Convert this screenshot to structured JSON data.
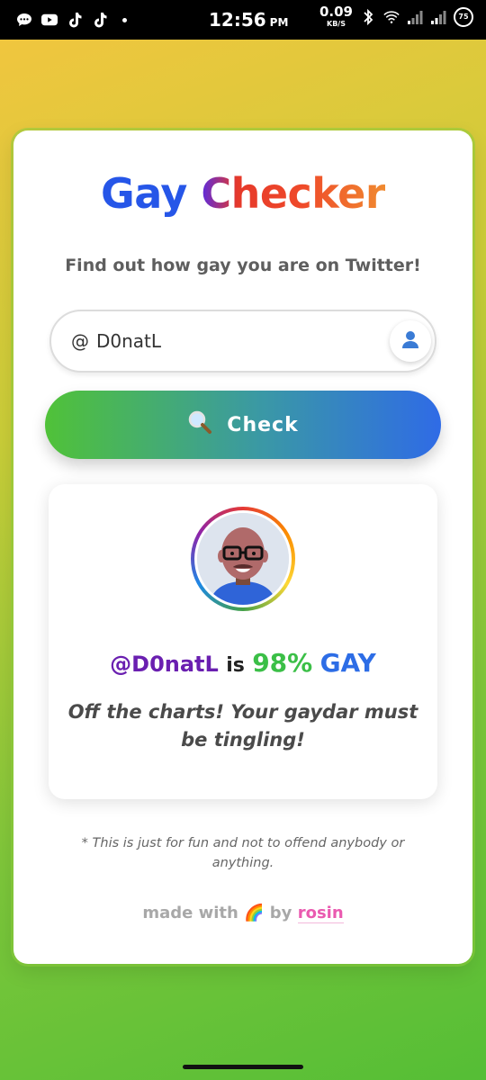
{
  "status_bar": {
    "time": "12:56",
    "ampm": "PM",
    "net_speed": "0.09",
    "net_unit": "KB/S",
    "battery": "75",
    "icons": [
      "message-icon",
      "youtube-icon",
      "tiktok-icon",
      "tiktok-icon",
      "bluetooth-icon",
      "wifi-icon",
      "signal-icon",
      "signal-icon",
      "battery-icon"
    ]
  },
  "app": {
    "title_part1": "Gay",
    "title_part2": "Checker",
    "subtitle": "Find out how gay you are on Twitter!",
    "input": {
      "prefix": "@",
      "value": "D0natL"
    },
    "check_button": {
      "icon": "search-icon",
      "label": "Check"
    }
  },
  "result": {
    "handle": "@D0natL",
    "is_word": "is",
    "percentage": "98%",
    "label": "GAY",
    "verdict": "Off the charts! Your gaydar must be tingling!"
  },
  "footer": {
    "disclaimer": "* This is just for fun and not to offend anybody or anything.",
    "made_with": "made with",
    "emoji": "🌈",
    "by": "by",
    "author": "rosin"
  },
  "colors": {
    "title_blue": "#2656e8",
    "handle_purple": "#6a1fb0",
    "pct_green": "#3bbf47",
    "gay_blue": "#2d6de6",
    "author_pink": "#ea5ab0"
  }
}
